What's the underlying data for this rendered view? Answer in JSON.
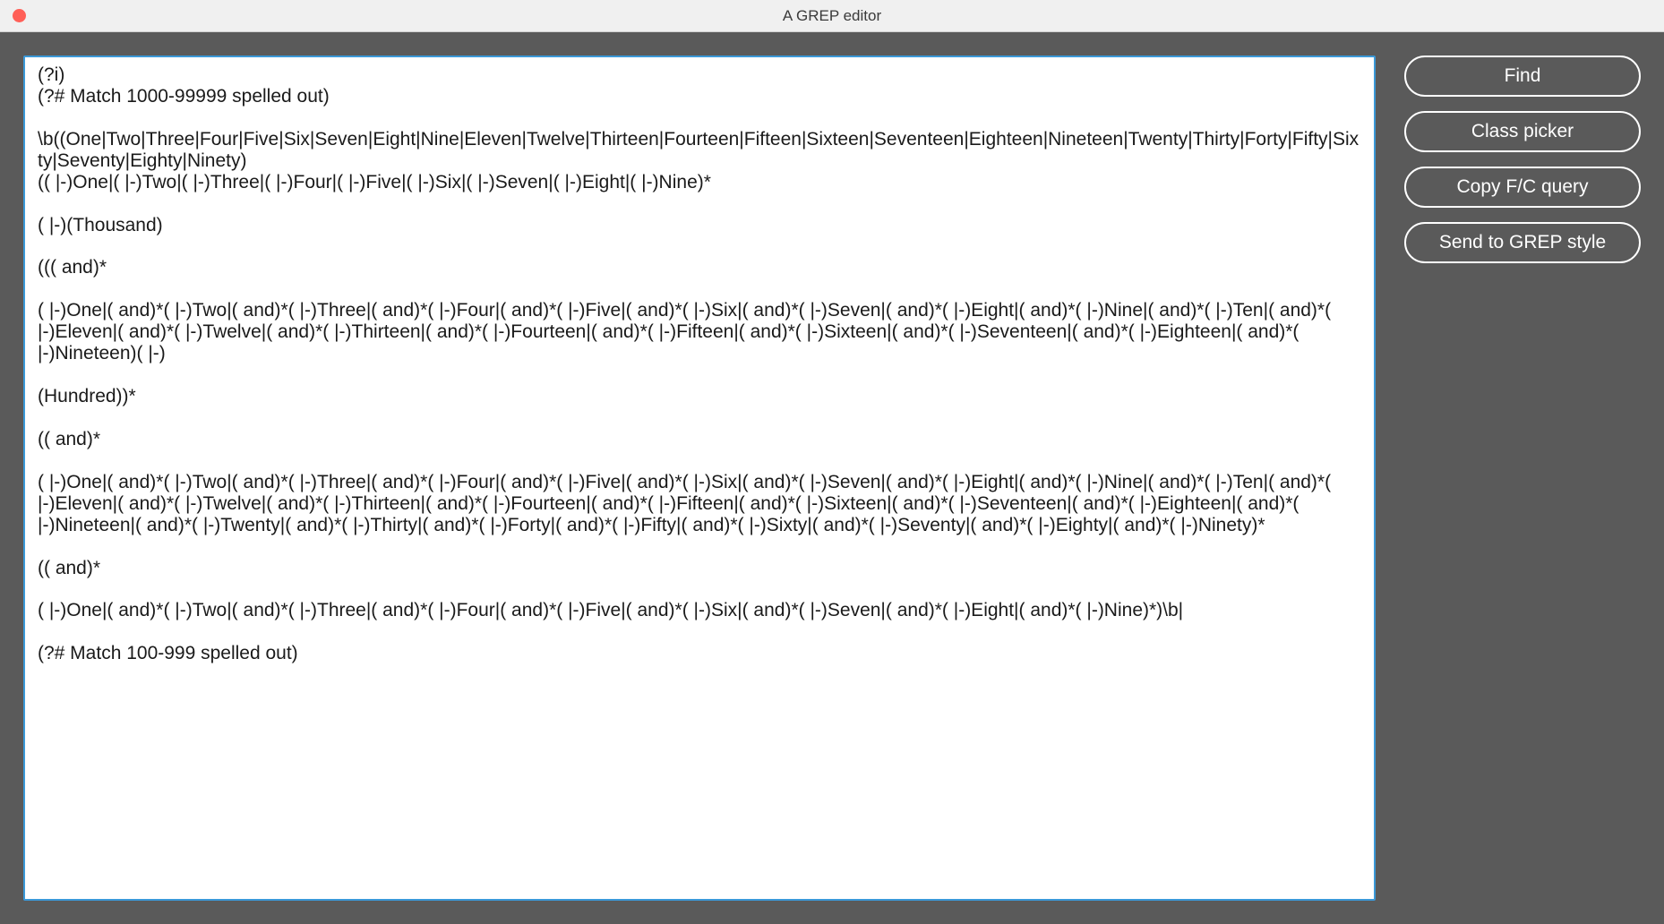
{
  "window": {
    "title": "A GREP editor"
  },
  "editor": {
    "content": "(?i)\n(?# Match 1000-99999 spelled out)\n\n\\b((One|Two|Three|Four|Five|Six|Seven|Eight|Nine|Eleven|Twelve|Thirteen|Fourteen|Fifteen|Sixteen|Seventeen|Eighteen|Nineteen|Twenty|Thirty|Forty|Fifty|Sixty|Seventy|Eighty|Ninety)\n(( |-)One|( |-)Two|( |-)Three|( |-)Four|( |-)Five|( |-)Six|( |-)Seven|( |-)Eight|( |-)Nine)*\n\n( |-)(Thousand)\n\n((( and)*\n\n( |-)One|( and)*( |-)Two|( and)*( |-)Three|( and)*( |-)Four|( and)*( |-)Five|( and)*( |-)Six|( and)*( |-)Seven|( and)*( |-)Eight|( and)*( |-)Nine|( and)*( |-)Ten|( and)*( |-)Eleven|( and)*( |-)Twelve|( and)*( |-)Thirteen|( and)*( |-)Fourteen|( and)*( |-)Fifteen|( and)*( |-)Sixteen|( and)*( |-)Seventeen|( and)*( |-)Eighteen|( and)*( |-)Nineteen)( |-)\n\n(Hundred))*\n\n(( and)*\n\n( |-)One|( and)*( |-)Two|( and)*( |-)Three|( and)*( |-)Four|( and)*( |-)Five|( and)*( |-)Six|( and)*( |-)Seven|( and)*( |-)Eight|( and)*( |-)Nine|( and)*( |-)Ten|( and)*( |-)Eleven|( and)*( |-)Twelve|( and)*( |-)Thirteen|( and)*( |-)Fourteen|( and)*( |-)Fifteen|( and)*( |-)Sixteen|( and)*( |-)Seventeen|( and)*( |-)Eighteen|( and)*( |-)Nineteen|( and)*( |-)Twenty|( and)*( |-)Thirty|( and)*( |-)Forty|( and)*( |-)Fifty|( and)*( |-)Sixty|( and)*( |-)Seventy|( and)*( |-)Eighty|( and)*( |-)Ninety)*\n\n(( and)*\n\n( |-)One|( and)*( |-)Two|( and)*( |-)Three|( and)*( |-)Four|( and)*( |-)Five|( and)*( |-)Six|( and)*( |-)Seven|( and)*( |-)Eight|( and)*( |-)Nine)*)\\b|\n\n(?# Match 100-999 spelled out)"
  },
  "sidebar": {
    "buttons": {
      "find": "Find",
      "class_picker": "Class picker",
      "copy_fc_query": "Copy F/C query",
      "send_to_grep_style": "Send to GREP style"
    }
  }
}
